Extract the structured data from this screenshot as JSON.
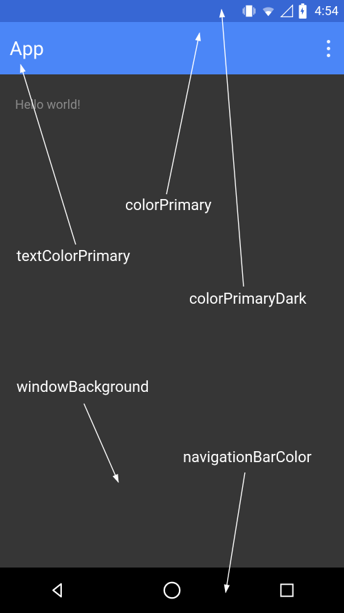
{
  "statusBar": {
    "time": "4:54"
  },
  "appBar": {
    "title": "App"
  },
  "content": {
    "hello": "Hello world!"
  },
  "labels": {
    "colorPrimary": "colorPrimary",
    "textColorPrimary": "textColorPrimary",
    "colorPrimaryDark": "colorPrimaryDark",
    "windowBackground": "windowBackground",
    "navigationBarColor": "navigationBarColor"
  },
  "colors": {
    "colorPrimaryDark": "#3767d4",
    "colorPrimary": "#4b86f7",
    "windowBackground": "#363636",
    "navigationBarColor": "#000000",
    "textColorPrimary": "#ffffff"
  }
}
